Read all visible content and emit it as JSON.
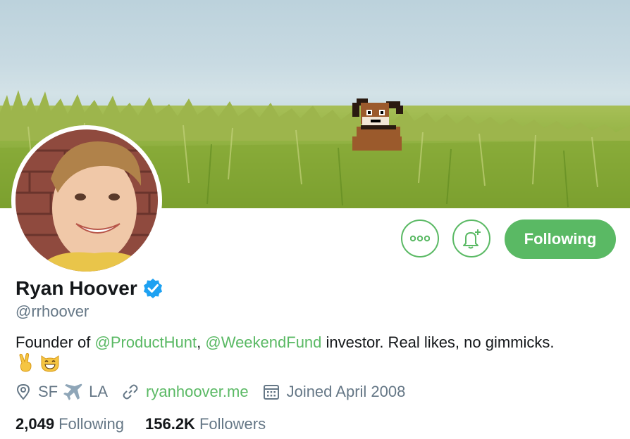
{
  "profile": {
    "name": "Ryan Hoover",
    "handle": "@rrhoover",
    "bio": {
      "prefix": "Founder of ",
      "mention1": "@ProductHunt",
      "sep": ", ",
      "mention2": "@WeekendFund",
      "suffix": " investor. Real likes, no gimmicks."
    },
    "bio_emojis": [
      "victory-hand-emoji",
      "grinning-cat-emoji"
    ]
  },
  "meta": {
    "location_from": "SF",
    "location_to": "LA",
    "website": "ryanhoover.me",
    "joined": "Joined April 2008"
  },
  "stats": {
    "following_count": "2,049",
    "following_label": "Following",
    "followers_count": "156.2K",
    "followers_label": "Followers"
  },
  "actions": {
    "follow_label": "Following",
    "more_icon": "more-dots-icon",
    "bell_icon": "notification-bell-plus-icon"
  },
  "colors": {
    "accent": "#5ab964",
    "verified": "#1da1f2",
    "text_primary": "#14171a",
    "text_secondary": "#657786"
  }
}
